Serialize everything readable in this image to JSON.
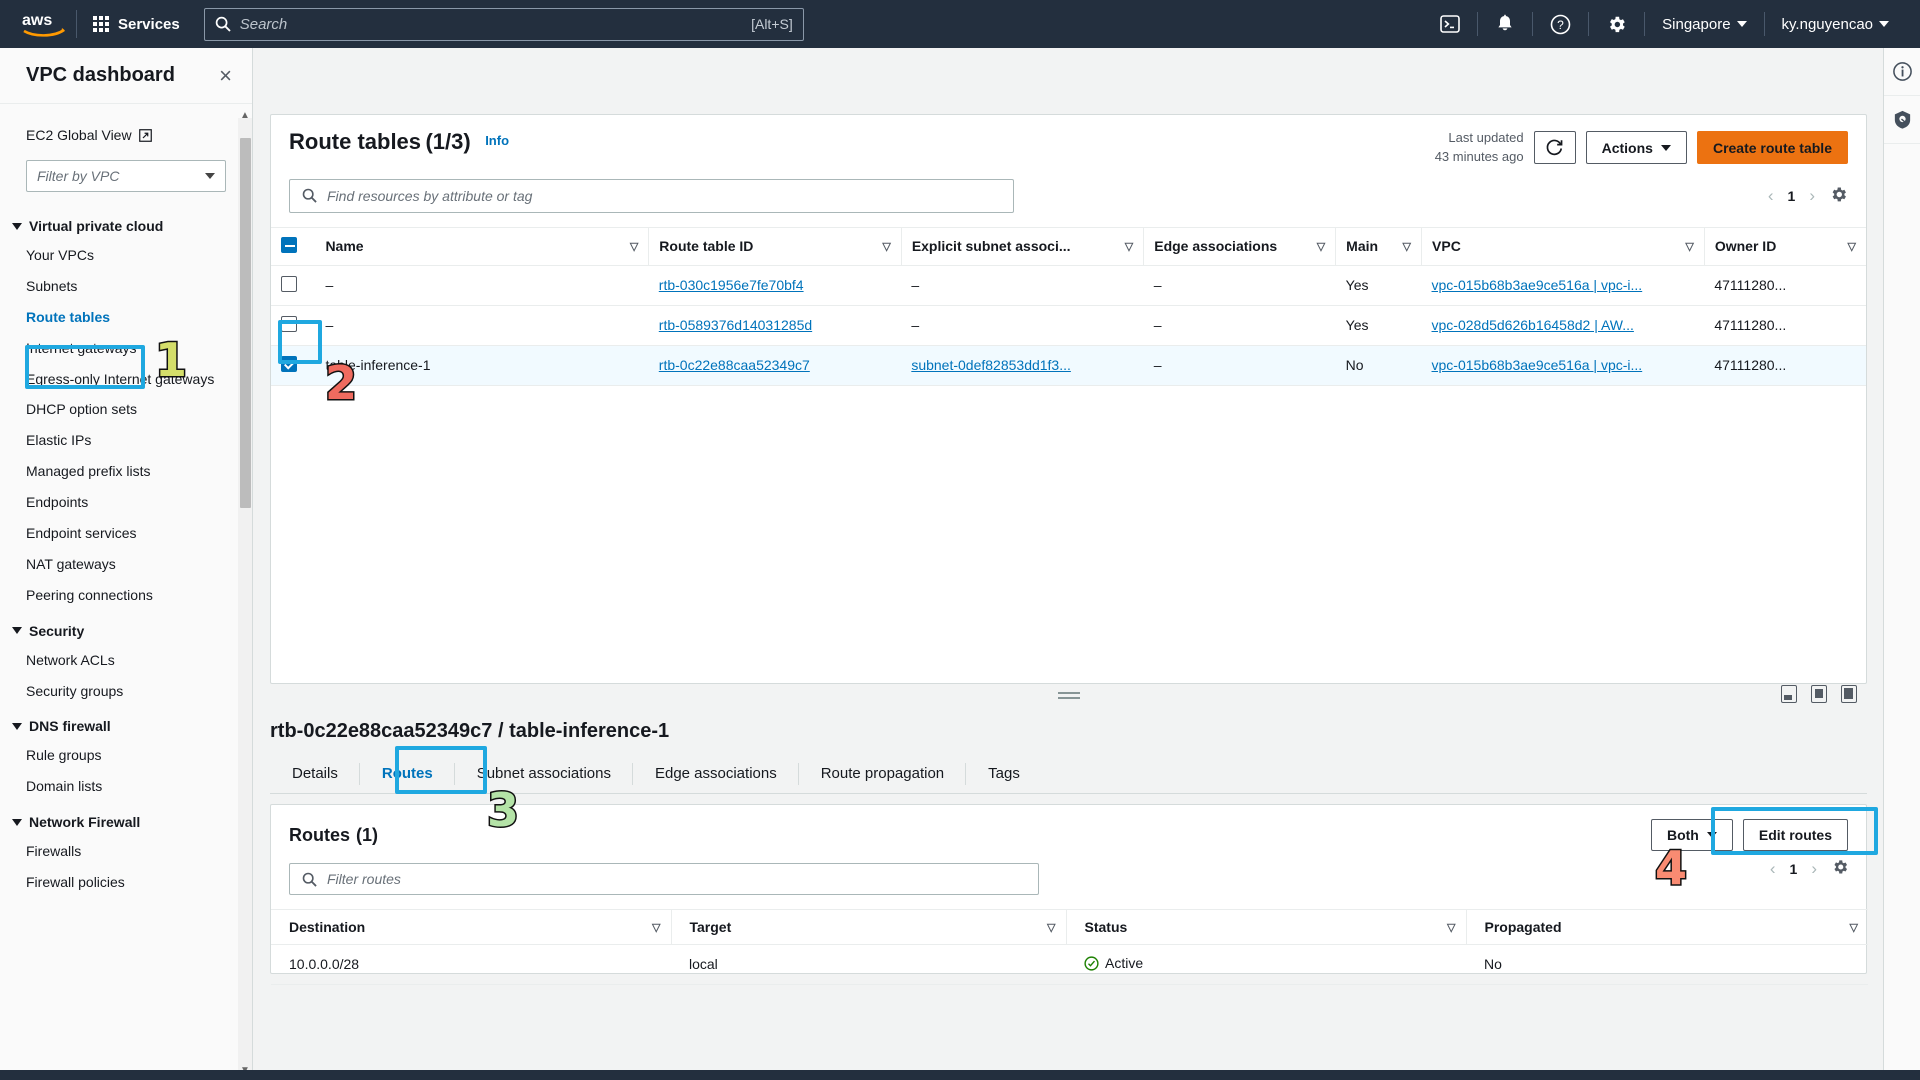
{
  "topnav": {
    "logo": "aws-logo",
    "services_label": "Services",
    "search_placeholder": "Search",
    "search_shortcut": "[Alt+S]",
    "icons": [
      "cloudshell-icon",
      "bell-icon",
      "help-icon",
      "settings-icon"
    ],
    "region": "Singapore",
    "account": "ky.nguyencao"
  },
  "sidebar": {
    "title": "VPC dashboard",
    "close": "×",
    "ec2_global_view": "EC2 Global View",
    "vpc_filter_placeholder": "Filter by VPC",
    "groups": [
      {
        "label": "Virtual private cloud",
        "items": [
          {
            "label": "Your VPCs",
            "selected": false
          },
          {
            "label": "Subnets",
            "selected": false
          },
          {
            "label": "Route tables",
            "selected": true
          },
          {
            "label": "Internet gateways",
            "selected": false
          },
          {
            "label": "Egress-only Internet gateways",
            "selected": false
          },
          {
            "label": "DHCP option sets",
            "selected": false
          },
          {
            "label": "Elastic IPs",
            "selected": false
          },
          {
            "label": "Managed prefix lists",
            "selected": false
          },
          {
            "label": "Endpoints",
            "selected": false
          },
          {
            "label": "Endpoint services",
            "selected": false
          },
          {
            "label": "NAT gateways",
            "selected": false
          },
          {
            "label": "Peering connections",
            "selected": false
          }
        ]
      },
      {
        "label": "Security",
        "items": [
          {
            "label": "Network ACLs",
            "selected": false
          },
          {
            "label": "Security groups",
            "selected": false
          }
        ]
      },
      {
        "label": "DNS firewall",
        "items": [
          {
            "label": "Rule groups",
            "selected": false
          },
          {
            "label": "Domain lists",
            "selected": false
          }
        ]
      },
      {
        "label": "Network Firewall",
        "items": [
          {
            "label": "Firewalls",
            "selected": false
          },
          {
            "label": "Firewall policies",
            "selected": false
          }
        ]
      }
    ]
  },
  "page": {
    "title": "Route tables",
    "count": "(1/3)",
    "info": "Info",
    "last_updated_label": "Last updated",
    "last_updated_value": "43 minutes ago",
    "refresh_icon": "refresh-icon",
    "actions_label": "Actions",
    "create_label": "Create route table",
    "find_placeholder": "Find resources by attribute or tag",
    "page_number": "1",
    "settings_icon": "gear-icon"
  },
  "route_tables": {
    "columns": [
      "Name",
      "Route table ID",
      "Explicit subnet associ...",
      "Edge associations",
      "Main",
      "VPC",
      "Owner ID"
    ],
    "rows": [
      {
        "selected": false,
        "name": "–",
        "route_table_id": "rtb-030c1956e7fe70bf4",
        "explicit_subnet": "–",
        "edge_associations": "–",
        "main": "Yes",
        "vpc": "vpc-015b68b3ae9ce516a | vpc-i...",
        "owner_id": "47111280..."
      },
      {
        "selected": false,
        "name": "–",
        "route_table_id": "rtb-0589376d14031285d",
        "explicit_subnet": "–",
        "edge_associations": "–",
        "main": "Yes",
        "vpc": "vpc-028d5d626b16458d2 | AW...",
        "owner_id": "47111280..."
      },
      {
        "selected": true,
        "name": "table-inference-1",
        "route_table_id": "rtb-0c22e88caa52349c7",
        "explicit_subnet": "subnet-0def82853dd1f3...",
        "edge_associations": "–",
        "main": "No",
        "vpc": "vpc-015b68b3ae9ce516a | vpc-i...",
        "owner_id": "47111280..."
      }
    ]
  },
  "detail": {
    "title": "rtb-0c22e88caa52349c7 / table-inference-1",
    "tabs": [
      {
        "label": "Details",
        "active": false
      },
      {
        "label": "Routes",
        "active": true
      },
      {
        "label": "Subnet associations",
        "active": false
      },
      {
        "label": "Edge associations",
        "active": false
      },
      {
        "label": "Route propagation",
        "active": false
      },
      {
        "label": "Tags",
        "active": false
      }
    ]
  },
  "routes": {
    "title": "Routes",
    "count": "(1)",
    "filter_placeholder": "Filter routes",
    "both_label": "Both",
    "edit_label": "Edit routes",
    "page_number": "1",
    "columns": [
      "Destination",
      "Target",
      "Status",
      "Propagated"
    ],
    "rows": [
      {
        "destination": "10.0.0.0/28",
        "target": "local",
        "status": "Active",
        "status_icon": "check-circle-icon",
        "propagated": "No"
      }
    ]
  },
  "rightrail": {
    "icons": [
      "info-circle-icon",
      "shield-icon"
    ]
  },
  "annotations": [
    {
      "number": "1",
      "color": "#d4de6a",
      "target": "sidebar-route-tables"
    },
    {
      "number": "2",
      "color": "#ef6b5f",
      "target": "row-checkbox"
    },
    {
      "number": "3",
      "color": "#b4e3a7",
      "target": "routes-tab"
    },
    {
      "number": "4",
      "color": "#f98b72",
      "target": "edit-routes-button"
    }
  ],
  "colors": {
    "nav_bg": "#232f3e",
    "accent_link": "#0073bb",
    "primary_button": "#ec7211",
    "highlight_border": "#1fa8e0",
    "selected_row": "#f1faff",
    "success": "#1d8102"
  }
}
